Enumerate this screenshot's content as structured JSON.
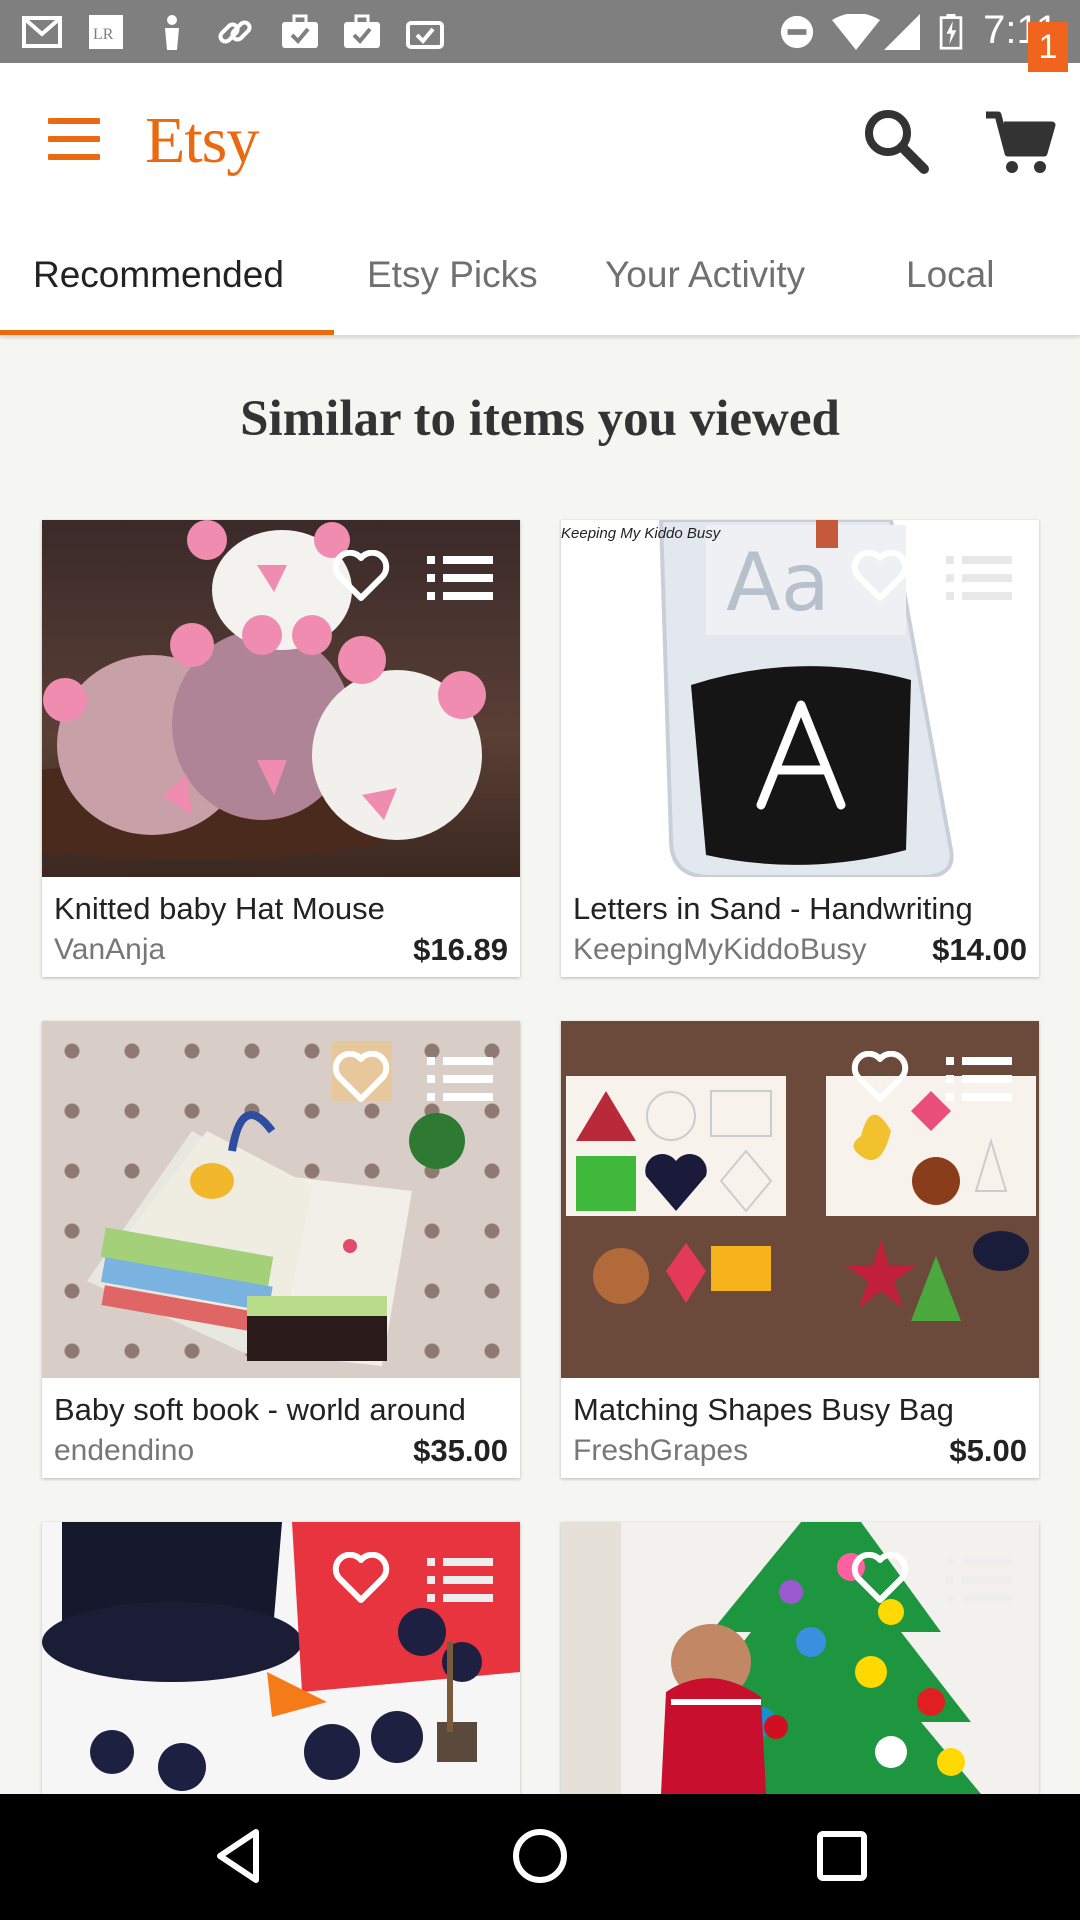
{
  "status_bar": {
    "time": "7:11"
  },
  "app_bar": {
    "logo": "Etsy",
    "cart_count": "1"
  },
  "tabs": [
    {
      "label": "Recommended",
      "active": true
    },
    {
      "label": "Etsy Picks",
      "active": false
    },
    {
      "label": "Your Activity",
      "active": false
    },
    {
      "label": "Local",
      "active": false
    }
  ],
  "section_title": "Similar to items you viewed",
  "items": [
    {
      "title": "Knitted baby Hat Mouse",
      "shop": "VanAnja",
      "price": "$16.89"
    },
    {
      "title": "Letters in Sand - Handwriting",
      "shop": "KeepingMyKiddoBusy",
      "price": "$14.00",
      "image_text": "Keeping My Kiddo Busy"
    },
    {
      "title": "Baby soft book - world around",
      "shop": "endendino",
      "price": "$35.00"
    },
    {
      "title": "Matching Shapes Busy Bag",
      "shop": "FreshGrapes",
      "price": "$5.00"
    },
    {
      "title": "",
      "shop": "",
      "price": ""
    },
    {
      "title": "",
      "shop": "",
      "price": ""
    }
  ],
  "colors": {
    "brand": "#ea6a12",
    "badge": "#f1641e"
  }
}
